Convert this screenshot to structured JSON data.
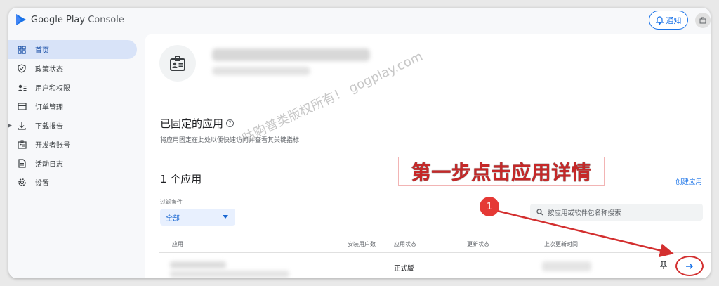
{
  "header": {
    "brand_google": "Google Play",
    "brand_console": "Console",
    "notify_label": "通知"
  },
  "sidebar": {
    "items": [
      {
        "label": "首页",
        "icon": "dashboard-icon"
      },
      {
        "label": "政策状态",
        "icon": "shield-icon"
      },
      {
        "label": "用户和权限",
        "icon": "users-permissions-icon"
      },
      {
        "label": "订单管理",
        "icon": "credit-card-icon"
      },
      {
        "label": "下载报告",
        "icon": "download-icon"
      },
      {
        "label": "开发者账号",
        "icon": "badge-icon"
      },
      {
        "label": "活动日志",
        "icon": "document-icon"
      },
      {
        "label": "设置",
        "icon": "gear-icon"
      }
    ]
  },
  "main": {
    "pinned_title": "已固定的应用",
    "pinned_help": "?",
    "pinned_desc": "将应用固定在此处以便快速访问并查看其关键指标",
    "app_count": "1 个应用",
    "create_app": "创建应用",
    "filter_label": "过滤条件",
    "filter_value": "全部",
    "search_placeholder": "按应用或软件包名称搜索",
    "columns": [
      "应用",
      "安装用户数",
      "应用状态",
      "更新状态",
      "上次更新时间"
    ],
    "row": {
      "status": "正式版"
    }
  },
  "annotation": {
    "watermark": "咕购普类版权所有！ gogplay.com",
    "step_text": "第一步点击应用详情",
    "badge": "1"
  },
  "colors": {
    "accent": "#1a73e8",
    "active_nav": "#d8e3f8",
    "annotation_red": "#d32f2f"
  }
}
